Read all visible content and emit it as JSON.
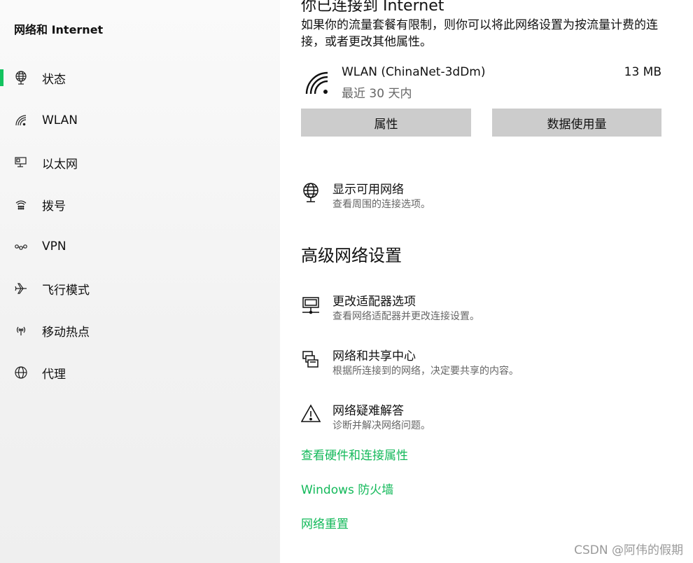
{
  "sidebar": {
    "title": "网络和 Internet",
    "items": [
      {
        "label": "状态",
        "icon": "globe-icon"
      },
      {
        "label": "WLAN",
        "icon": "wifi-icon"
      },
      {
        "label": "以太网",
        "icon": "ethernet-icon"
      },
      {
        "label": "拨号",
        "icon": "dialup-icon"
      },
      {
        "label": "VPN",
        "icon": "vpn-icon"
      },
      {
        "label": "飞行模式",
        "icon": "airplane-icon"
      },
      {
        "label": "移动热点",
        "icon": "hotspot-icon"
      },
      {
        "label": "代理",
        "icon": "proxy-globe-icon"
      }
    ],
    "active_index": 0
  },
  "main": {
    "heading": "你已连接到 Internet",
    "description": "如果你的流量套餐有限制，则你可以将此网络设置为按流量计费的连接，或者更改其他属性。",
    "wlan": {
      "name": "WLAN (ChinaNet-3dDm)",
      "period": "最近 30 天内",
      "usage": "13 MB"
    },
    "buttons": {
      "properties": "属性",
      "data_usage": "数据使用量"
    },
    "show_networks": {
      "title": "显示可用网络",
      "subtitle": "查看周围的连接选项。"
    },
    "advanced_title": "高级网络设置",
    "advanced": [
      {
        "title": "更改适配器选项",
        "subtitle": "查看网络适配器并更改连接设置。"
      },
      {
        "title": "网络和共享中心",
        "subtitle": "根据所连接到的网络，决定要共享的内容。"
      },
      {
        "title": "网络疑难解答",
        "subtitle": "诊断并解决网络问题。"
      }
    ],
    "links": [
      "查看硬件和连接属性",
      "Windows 防火墙",
      "网络重置"
    ]
  },
  "watermark": "CSDN @阿伟的假期",
  "colors": {
    "accent": "#13c35f",
    "link": "#13b95a",
    "button_bg": "#cccccc"
  }
}
